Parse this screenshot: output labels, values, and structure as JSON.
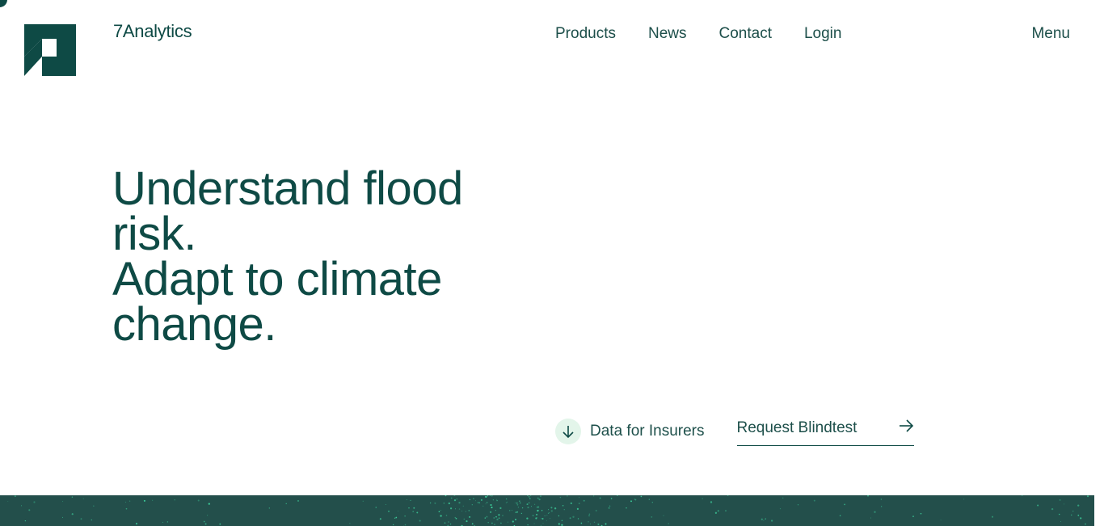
{
  "brand": {
    "name": "7Analytics",
    "logo_icon": "7analytics-logo-icon",
    "color_primary": "#0e4a45",
    "color_band": "#234f4b",
    "color_accent_soft": "#e3f5ea",
    "color_speckle": "#3fd6a0"
  },
  "nav": {
    "items": [
      {
        "label": "Products"
      },
      {
        "label": "News"
      },
      {
        "label": "Contact"
      },
      {
        "label": "Login"
      }
    ],
    "menu_label": "Menu"
  },
  "hero": {
    "line1": "Understand flood",
    "line2": "risk.",
    "line3": "Adapt to climate",
    "line4": "change."
  },
  "cta": {
    "scroll_label": "Data for Insurers",
    "scroll_icon": "arrow-down-icon",
    "blindtest_label": "Request Blindtest",
    "blindtest_icon": "arrow-right-icon"
  }
}
